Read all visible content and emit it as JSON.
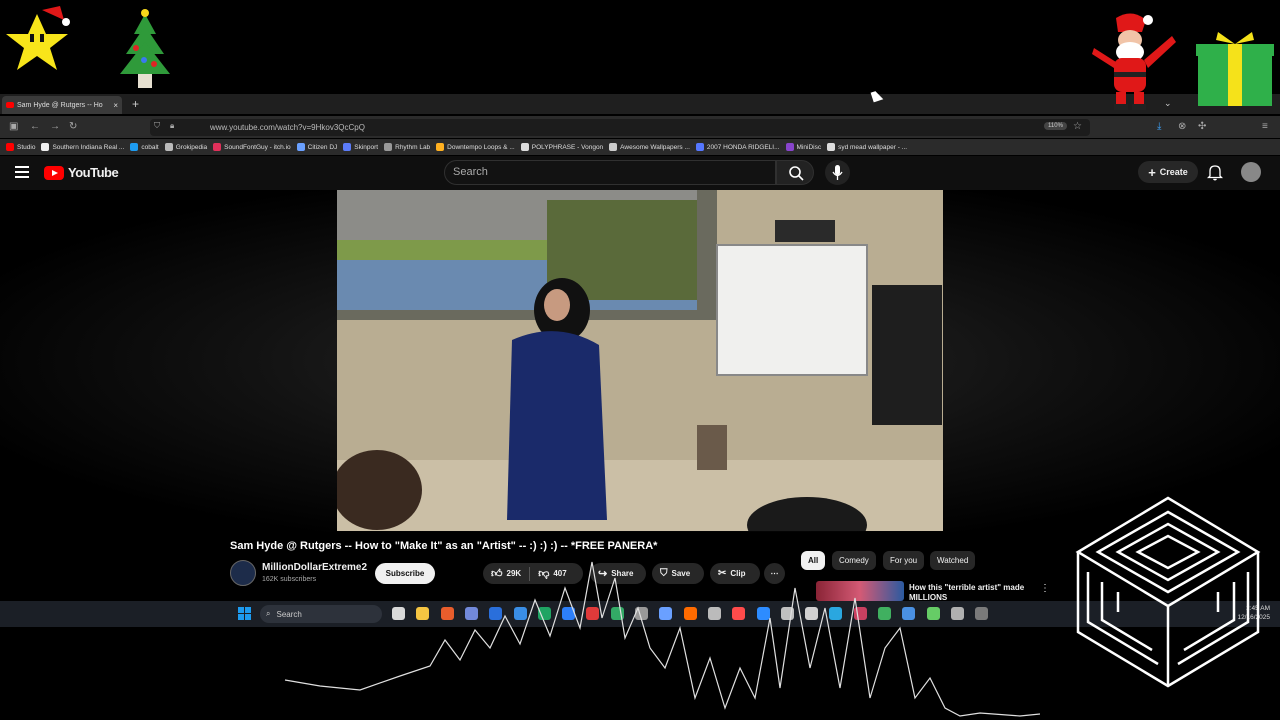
{
  "browser": {
    "tab_title": "Sam Hyde @ Rutgers -- Ho",
    "tab_close": "×",
    "new_tab": "+",
    "tab_list": "⌄",
    "url": "www.youtube.com/watch?v=9Hkov3QcCpQ",
    "zoom": "110%",
    "bookmarks": [
      {
        "label": "Studio",
        "color": "#ff0000"
      },
      {
        "label": "Southern Indiana Real ...",
        "color": "#f0f0f0"
      },
      {
        "label": "cobalt",
        "color": "#1d9bf0"
      },
      {
        "label": "Grokipedia",
        "color": "#bbbbbb"
      },
      {
        "label": "SoundFontGuy - itch.io",
        "color": "#e0305a"
      },
      {
        "label": "Citizen DJ",
        "color": "#6aa0ff"
      },
      {
        "label": "Skinport",
        "color": "#5c7cfa"
      },
      {
        "label": "Rhythm Lab",
        "color": "#999999"
      },
      {
        "label": "Downtempo Loops & ...",
        "color": "#ffb020"
      },
      {
        "label": "POLYPHRASE - Vongon",
        "color": "#dddddd"
      },
      {
        "label": "Awesome Wallpapers ...",
        "color": "#cccccc"
      },
      {
        "label": "2007 HONDA RIDGELI...",
        "color": "#5577ff"
      },
      {
        "label": "MiniDisc",
        "color": "#8844cc"
      },
      {
        "label": "syd mead wallpaper - ...",
        "color": "#dddddd"
      }
    ]
  },
  "youtube": {
    "logo_text": "YouTube",
    "search_placeholder": "Search",
    "create_label": "Create",
    "video_title": "Sam Hyde @ Rutgers -- How to \"Make It\" as an \"Artist\" -- :) :) :) -- *FREE PANERA*",
    "channel_name": "MillionDollarExtreme2",
    "subscribers": "162K subscribers",
    "subscribe_label": "Subscribe",
    "likes": "29K",
    "dislikes": "407",
    "share_label": "Share",
    "save_label": "Save",
    "clip_label": "Clip",
    "more_label": "⋯",
    "chips": [
      "All",
      "Comedy",
      "For you",
      "Watched"
    ],
    "rec_title": "How this \"terrible artist\" made MILLIONS",
    "rec_more": "⋮"
  },
  "taskbar": {
    "search_label": "Search",
    "time": "2:45 AM",
    "date": "12/16/2025",
    "icon_colors": [
      "#d9d9d9",
      "#f5c542",
      "#e85d2c",
      "#7289da",
      "#2a6fdb",
      "#3a8ee6",
      "#1fa463",
      "#2d7ff9",
      "#e03a3a",
      "#33aa66",
      "#999999",
      "#6aa0ff",
      "#ff6b00",
      "#bbbbbb",
      "#ff4b4b",
      "#2d8cff",
      "#c0c0c0",
      "#d1d1d1",
      "#2aa7e0",
      "#c94060",
      "#40b060",
      "#4a90e2",
      "#66cc66",
      "#b0b0b0",
      "#7a7a7a"
    ]
  }
}
